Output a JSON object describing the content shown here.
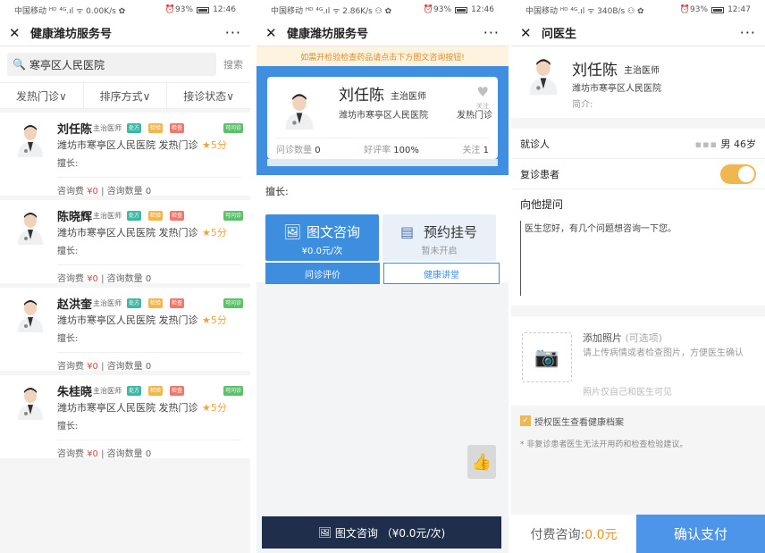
{
  "status": {
    "p1": {
      "left": "中国移动 ᴴᴰ ⁴ᴳ.ıl ᯤ 0.00K/s ✿",
      "right": "⏰93%",
      "time": "12:46"
    },
    "p2": {
      "left": "中国移动 ᴴᴰ ⁴ᴳ.ıl ᯤ 2.86K/s ⚇ ✿",
      "right": "⏰93%",
      "time": "12:46"
    },
    "p3": {
      "left": "中国移动 ᴴᴰ ⁴ᴳ.ıl ᯤ 340B/s ⚇ ✿",
      "right": "⏰93%",
      "time": "12:47"
    }
  },
  "p1": {
    "title": "健康潍坊服务号",
    "search_value": "寒亭区人民医院",
    "search_button": "搜索",
    "filters": [
      "发热门诊∨",
      "排序方式∨",
      "接诊状态∨"
    ],
    "doctors": [
      {
        "name": "刘任陈",
        "rank": "主治医师",
        "tags": [
          "处方",
          "检验",
          "检查"
        ],
        "status": "可问诊",
        "hospital": "潍坊市寒亭区人民医院",
        "dept": "发热门诊",
        "score": "★5分",
        "specialty": "擅长:",
        "fee_label": "咨询费",
        "fee": "¥0",
        "count_label": "咨询数量 0"
      },
      {
        "name": "陈晓辉",
        "rank": "主治医师",
        "tags": [
          "处方",
          "检验",
          "检查"
        ],
        "status": "可问诊",
        "hospital": "潍坊市寒亭区人民医院",
        "dept": "发热门诊",
        "score": "★5分",
        "specialty": "擅长:",
        "fee_label": "咨询费",
        "fee": "¥0",
        "count_label": "咨询数量 0"
      },
      {
        "name": "赵洪奎",
        "rank": "主治医师",
        "tags": [
          "处方",
          "检验",
          "检查"
        ],
        "status": "可问诊",
        "hospital": "潍坊市寒亭区人民医院",
        "dept": "发热门诊",
        "score": "★5分",
        "specialty": "擅长:",
        "fee_label": "咨询费",
        "fee": "¥0",
        "count_label": "咨询数量 0"
      },
      {
        "name": "朱桂晓",
        "rank": "主治医师",
        "tags": [
          "处方",
          "检验",
          "检查"
        ],
        "status": "可问诊",
        "hospital": "潍坊市寒亭区人民医院",
        "dept": "发热门诊",
        "score": "★5分",
        "specialty": "擅长:",
        "fee_label": "咨询费",
        "fee": "¥0",
        "count_label": "咨询数量 0"
      }
    ]
  },
  "p2": {
    "title": "健康潍坊服务号",
    "notice": "如需开检验检查药品请点击下方图文咨询按钮!",
    "doctor": {
      "name": "刘任陈",
      "rank": "主治医师",
      "hospital": "潍坊市寒亭区人民医院",
      "dept": "发热门诊",
      "follow": "关注"
    },
    "stats": {
      "count_label": "问诊数量",
      "count": "0",
      "rate_label": "好评率",
      "rate": "100%",
      "follow_label": "关注",
      "follow": "1"
    },
    "specialty": "擅长:",
    "service1": {
      "label": "图文咨询",
      "sub": "¥0.0元/次"
    },
    "service2": {
      "label": "预约挂号",
      "sub": "暂未开启"
    },
    "tab_review": "问诊评价",
    "tab_lecture": "健康讲堂",
    "bottom_button": "图文咨询 （¥0.0元/次)"
  },
  "p3": {
    "title": "问医生",
    "doctor": {
      "name": "刘任陈",
      "rank": "主治医师",
      "hospital": "潍坊市寒亭区人民医院",
      "intro": "简介:"
    },
    "patient_label": "就诊人",
    "patient_value": "男 46岁",
    "revisit_label": "复诊患者",
    "ask_title": "向他提问",
    "ask_text": "医生您好，有几个问题想咨询一下您。",
    "photo_title": "添加照片",
    "photo_optional": "(可选项)",
    "photo_hint": "请上传病情或者检查图片，方便医生确认",
    "photo_privacy": "照片仅自己和医生可见",
    "auth_label": "授权医生查看健康档案",
    "note": "* 非复诊患者医生无法开用药和检查检验建议。",
    "pay_label": "付费咨询:",
    "pay_amount": "0.0元",
    "confirm_button": "确认支付"
  }
}
